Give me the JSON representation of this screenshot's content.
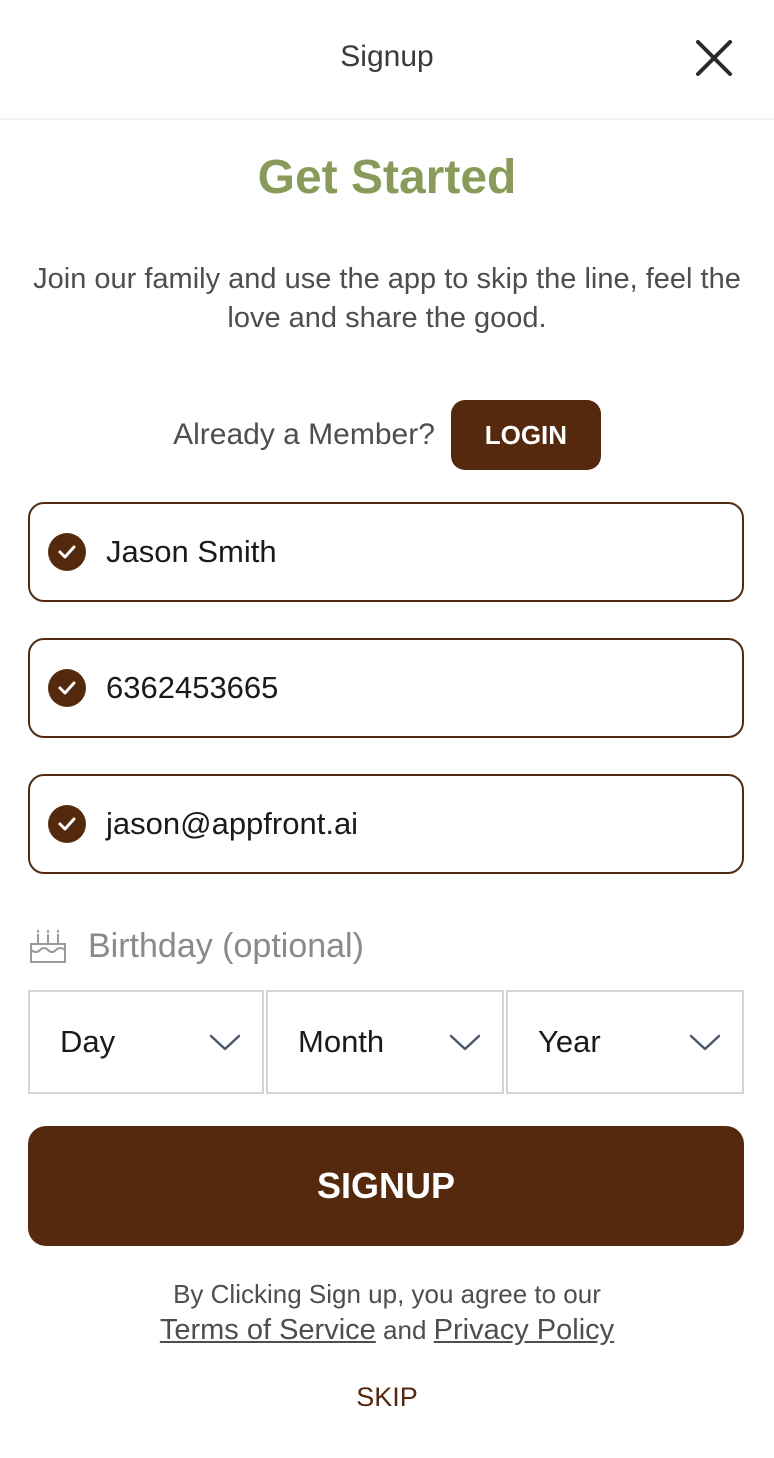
{
  "header": {
    "title": "Signup",
    "close_icon": "close-icon"
  },
  "hero": {
    "headline": "Get Started",
    "intro": "Join our family and use the app to skip the line, feel the love and share the good."
  },
  "member": {
    "prompt": "Already a Member?",
    "login_label": "LOGIN"
  },
  "fields": {
    "name": {
      "value": "Jason Smith",
      "icon": "check-circle-icon"
    },
    "phone": {
      "value": "6362453665",
      "icon": "check-circle-icon"
    },
    "email": {
      "value": "jason@appfront.ai",
      "icon": "check-circle-icon"
    }
  },
  "birthday": {
    "icon": "cake-icon",
    "label": "Birthday (optional)",
    "day": "Day",
    "month": "Month",
    "year": "Year"
  },
  "actions": {
    "signup_label": "SIGNUP",
    "skip_label": "SKIP"
  },
  "legal": {
    "prefix": "By Clicking Sign up, you agree to our",
    "terms": "Terms of Service",
    "and": "and",
    "privacy": "Privacy Policy"
  },
  "colors": {
    "brand_brown": "#55290d",
    "headline_green": "#8a9a5b"
  }
}
